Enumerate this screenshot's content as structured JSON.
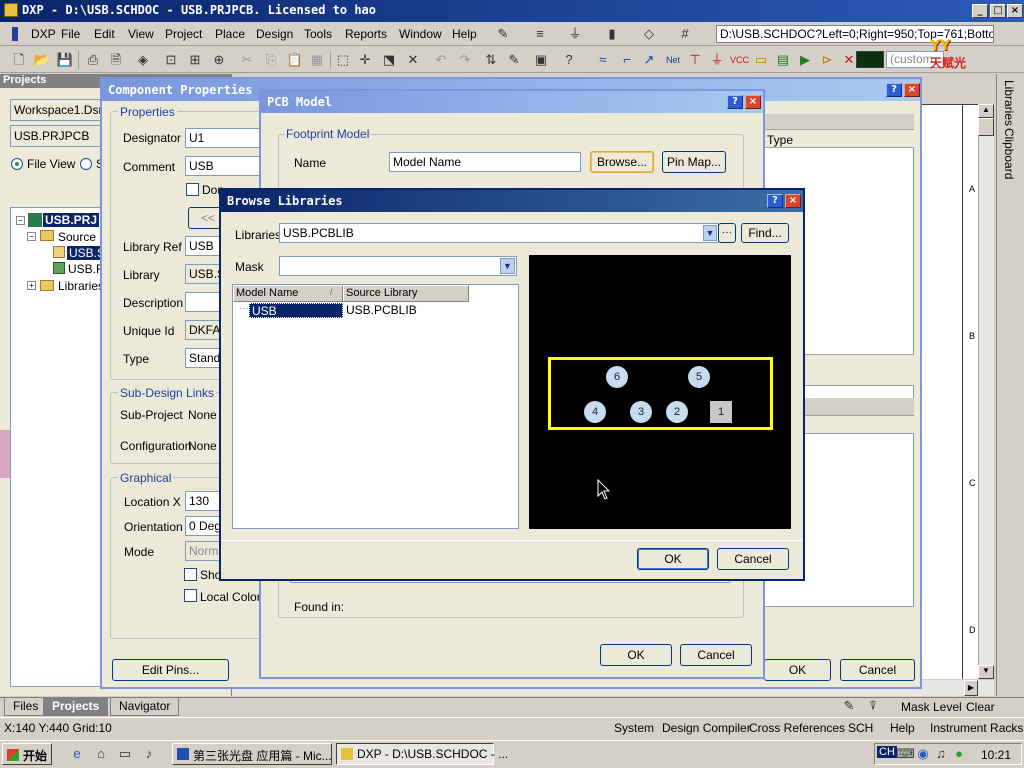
{
  "app": {
    "title": "DXP - D:\\USB.SCHDOC - USB.PRJPCB. Licensed to hao",
    "menu": [
      "DXP",
      "File",
      "Edit",
      "View",
      "Project",
      "Place",
      "Design",
      "Tools",
      "Reports",
      "Window",
      "Help"
    ],
    "location_box": "D:\\USB.SCHDOC?Left=0;Right=950;Top=761;Bottom=",
    "custom_box": "(custom",
    "logo_text": "天赋光"
  },
  "left_panel": {
    "title": "Projects",
    "workspace": "Workspace1.Dsn",
    "project": "USB.PRJPCB",
    "file_view": "File View",
    "structure_view": "S",
    "tree": {
      "root": "USB.PRJ",
      "source": "Source D",
      "doc1": "USB.S",
      "doc2": "USB.F",
      "libraries": "Libraries"
    },
    "tabs": [
      "Files",
      "Projects",
      "Navigator"
    ]
  },
  "right_sidebar": {
    "tabs": [
      "Libraries",
      "Clipboard"
    ]
  },
  "sheet": {
    "zones": [
      "A",
      "B",
      "C",
      "D"
    ]
  },
  "component_properties": {
    "title": "Component Properties",
    "properties_group": "Properties",
    "designator_label": "Designator",
    "designator": "U1",
    "comment_label": "Comment",
    "comment": "USB",
    "dont_annotate": "Don",
    "prev_btn": "<<",
    "library_ref_label": "Library Ref",
    "library_ref": "USB",
    "library_label": "Library",
    "library": "USB.S",
    "description_label": "Description",
    "description": "",
    "unique_id_label": "Unique Id",
    "unique_id": "DKFA",
    "type_label": "Type",
    "type": "Stand",
    "sub_design_group": "Sub-Design Links",
    "sub_project_label": "Sub-Project",
    "sub_project": "None",
    "configuration_label": "Configuration",
    "configuration": "None",
    "graphical_group": "Graphical",
    "location_label": "Location  X",
    "location_x": "130",
    "orientation_label": "Orientation",
    "orientation": "0 Deg",
    "mode_label": "Mode",
    "mode": "Norm",
    "show_label": "Sho",
    "local_colors_label": "Local Colors",
    "edit_pins": "Edit Pins...",
    "type_col": "Type",
    "ok": "OK",
    "cancel": "Cancel"
  },
  "pcb_model": {
    "title": "PCB Model",
    "footprint_group": "Footprint Model",
    "name_label": "Name",
    "name": "Model Name",
    "browse": "Browse...",
    "pin_map": "Pin Map...",
    "found_in_label": "Found in:",
    "ok": "OK",
    "cancel": "Cancel"
  },
  "browse_libraries": {
    "title": "Browse Libraries",
    "libraries_label": "Libraries",
    "libraries_value": "USB.PCBLIB",
    "ellipsis": "···",
    "find": "Find...",
    "mask_label": "Mask",
    "mask_value": "",
    "columns": [
      "Model Name",
      "Source Library"
    ],
    "rows": [
      {
        "model": "USB",
        "source": "USB.PCBLIB"
      }
    ],
    "pads": [
      "6",
      "5",
      "4",
      "3",
      "2",
      "1"
    ],
    "ok": "OK",
    "cancel": "Cancel"
  },
  "status_bar": {
    "coords": "X:140 Y:440   Grid:10",
    "items": [
      "System",
      "Design Compiler",
      "Cross References",
      "SCH",
      "Help",
      "Instrument Racks"
    ],
    "mask_level": "Mask Level",
    "clear": "Clear"
  },
  "taskbar": {
    "start": "开始",
    "tasks": [
      "第三张光盘 应用篇 - Mic...",
      "DXP - D:\\USB.SCHDOC - ..."
    ],
    "lang": "CH",
    "clock": "10:21"
  },
  "colors": {
    "titlebar": "#0a246a",
    "preview_bg": "#000000",
    "outline": "#ffff00",
    "pad": "#c8dcf0",
    "selection": "#0a246a"
  }
}
